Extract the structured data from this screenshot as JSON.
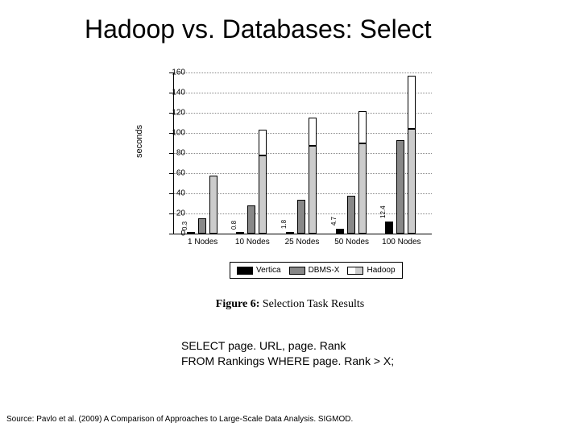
{
  "title": "Hadoop vs. Databases: Select",
  "chart_data": {
    "type": "bar",
    "categories": [
      "1 Nodes",
      "10 Nodes",
      "25 Nodes",
      "50 Nodes",
      "100 Nodes"
    ],
    "series": [
      {
        "name": "Vertica",
        "values": [
          0.3,
          0.8,
          1.8,
          4.7,
          12.4
        ],
        "labels": [
          "0.3",
          "0.8",
          "1.8",
          "4.7",
          "12.4"
        ]
      },
      {
        "name": "DBMS-X",
        "values": [
          15,
          28,
          34,
          38,
          93
        ]
      },
      {
        "name": "Hadoop-lower",
        "values": [
          58,
          78,
          87,
          90,
          104
        ]
      },
      {
        "name": "Hadoop-upper",
        "values": [
          58,
          103,
          115,
          122,
          157
        ]
      }
    ],
    "ylabel": "seconds",
    "ylim": [
      0,
      160
    ],
    "yticks": [
      0,
      20,
      40,
      60,
      80,
      100,
      120,
      140,
      160
    ],
    "legend": [
      "Vertica",
      "DBMS-X",
      "Hadoop"
    ]
  },
  "figure": {
    "label": "Figure 6:",
    "caption": "Selection Task Results"
  },
  "query": {
    "line1": "SELECT page. URL, page. Rank",
    "line2": "FROM Rankings WHERE page. Rank > X;"
  },
  "source": "Source: Pavlo et al. (2009) A Comparison of Approaches to Large-Scale Data Analysis. SIGMOD."
}
